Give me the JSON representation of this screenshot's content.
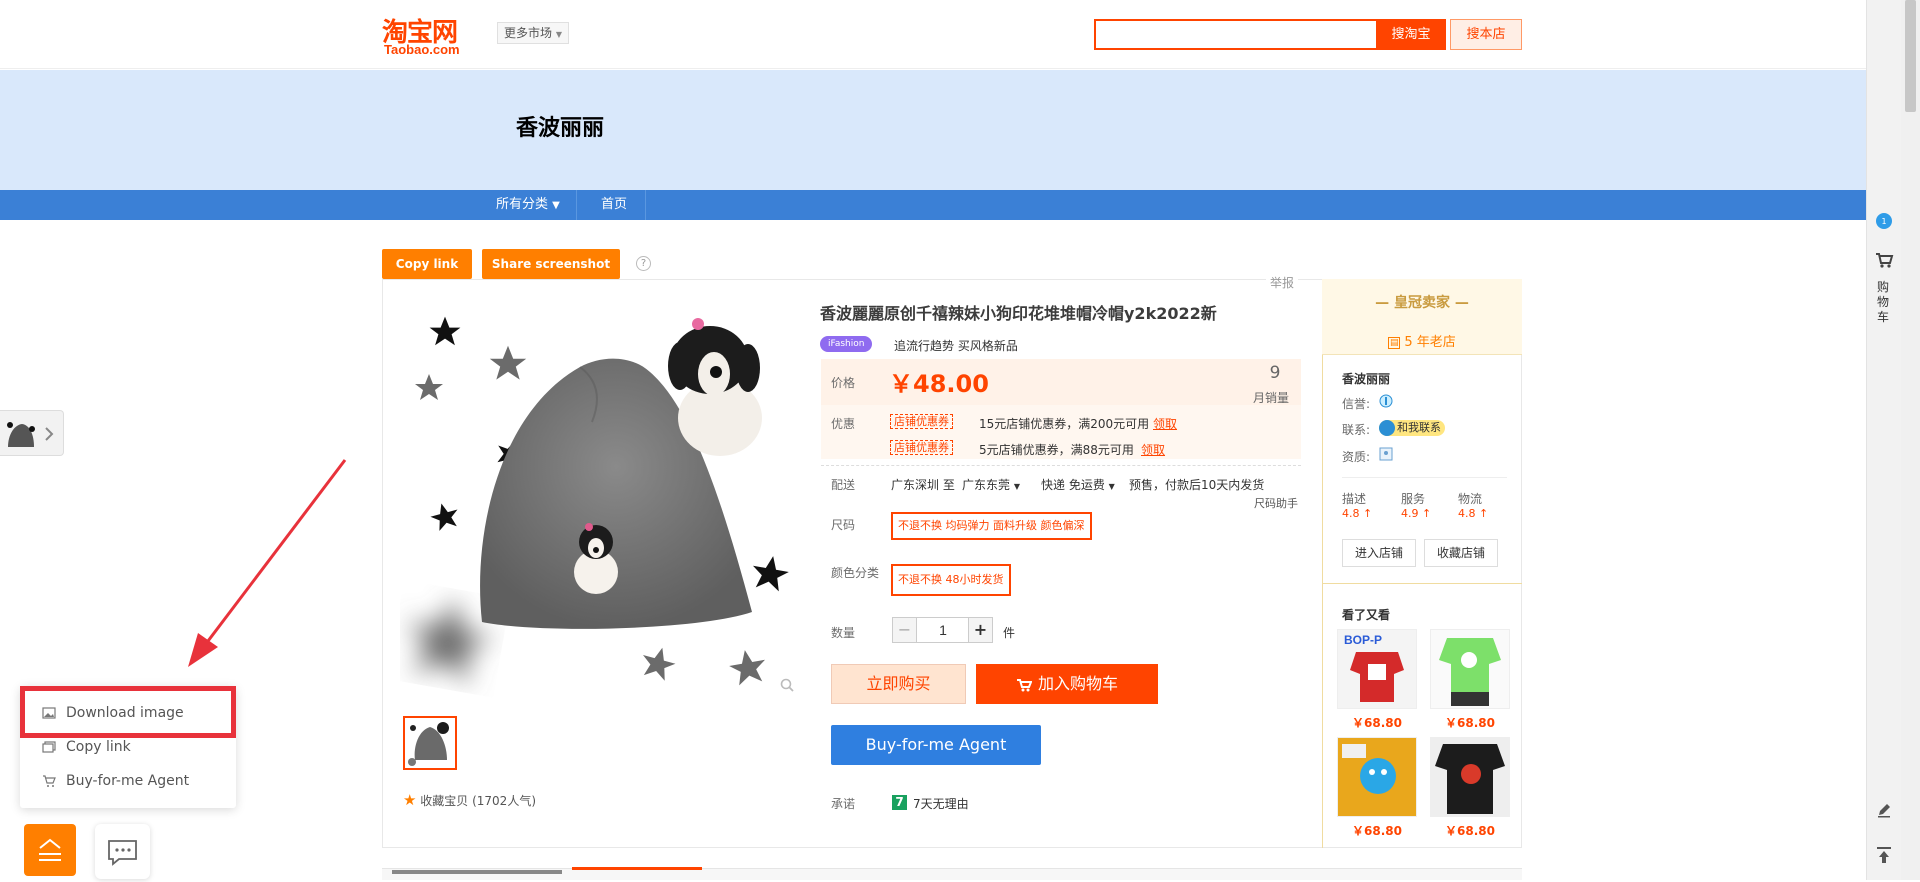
{
  "header": {
    "logo_cn": "淘宝网",
    "logo_en": "Taobao.com",
    "market_label": "更多市场",
    "search_value": "",
    "search_button": "搜淘宝",
    "search_shop_button": "搜本店"
  },
  "banner": {
    "shop_name": "香波丽丽"
  },
  "shop_nav": {
    "items": [
      "所有分类",
      "首页"
    ]
  },
  "actions": {
    "copy_link": "Copy link",
    "share_screenshot": "Share screenshot",
    "help": "?"
  },
  "report_label": "举报",
  "product": {
    "title": "香波麗麗原创千禧辣妹小狗印花堆堆帽冷帽y2k2022新",
    "tag": "iFashion",
    "subtitle": "追流行趋势 买风格新品",
    "price_label": "价格",
    "price": "￥48.00",
    "sales_num": "9",
    "sales_label": "月销量",
    "promo_label": "优惠",
    "coupons": [
      {
        "badge": "店铺优惠券",
        "text": "15元店铺优惠券，满200元可用",
        "action": "领取"
      },
      {
        "badge": "店铺优惠券",
        "text": "5元店铺优惠券，满88元可用",
        "action": "领取"
      }
    ],
    "ship_label": "配送",
    "ship_from": "广东深圳 至",
    "ship_to": "广东东莞",
    "ship_method": "快递 免运费",
    "ship_note": "预售，付款后10天内发货",
    "size_helper": "尺码助手",
    "size_label": "尺码",
    "size_option": "不退不换 均码弹力 面料升级 颜色偏深",
    "color_label": "颜色分类",
    "color_option": "不退不换 48小时发货",
    "qty_label": "数量",
    "qty_value": "1",
    "qty_unit": "件",
    "qty_minus": "−",
    "qty_plus": "+",
    "buy_now": "立即购买",
    "add_to_cart": "加入购物车",
    "agent_button": "Buy-for-me Agent",
    "promise_label": "承诺",
    "promise_icon": "7",
    "promise_text": "7天无理由",
    "favorite": "收藏宝贝 (1702人气)"
  },
  "seller": {
    "crown": "皇冠卖家",
    "years": "5 年老店",
    "shop_name": "香波丽丽",
    "credit_label": "信誉:",
    "contact_label": "联系:",
    "contact_chat": "和我联系",
    "qualification_label": "资质:",
    "stats": [
      {
        "label": "描述",
        "value": "4.8"
      },
      {
        "label": "服务",
        "value": "4.9"
      },
      {
        "label": "物流",
        "value": "4.8"
      }
    ],
    "enter_shop": "进入店铺",
    "favorite_shop": "收藏店铺",
    "also_viewed": "看了又看",
    "recommendations": [
      {
        "price": "￥68.80"
      },
      {
        "price": "￥68.80"
      },
      {
        "price": "￥68.80"
      },
      {
        "price": "￥68.80"
      }
    ]
  },
  "right_sidebar": {
    "cart_label": "购物车",
    "badge": "1"
  },
  "plugin_menu": {
    "items": [
      "Download image",
      "Copy link",
      "Buy-for-me Agent"
    ]
  },
  "colors": {
    "taobao_orange": "#ff4400",
    "accent_orange": "#ff7f00",
    "nav_blue": "#3b80d6",
    "agent_blue": "#2f7fe0",
    "highlight_red": "#e8323b"
  }
}
